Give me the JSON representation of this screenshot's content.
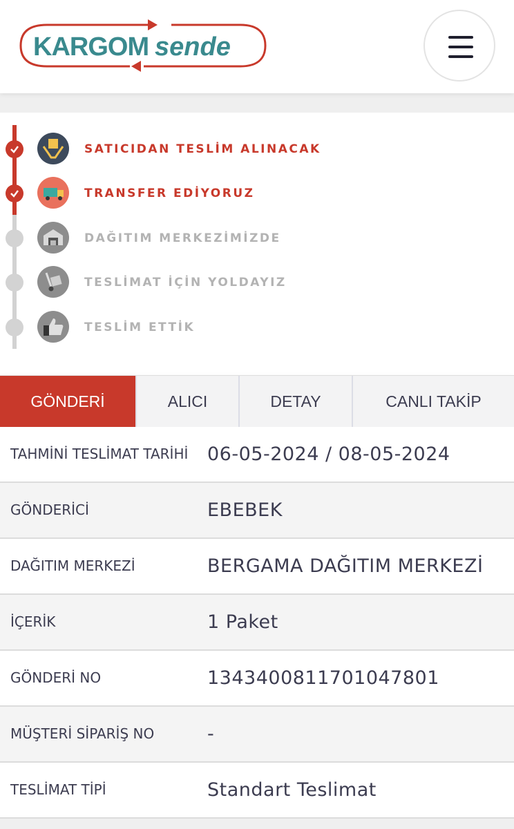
{
  "brand": {
    "part1": "KARGOM",
    "part2": "sende"
  },
  "colors": {
    "accent": "#c8392b",
    "brand_teal": "#3a8a8e",
    "text": "#3c3c50",
    "inactive": "#b3b3b3"
  },
  "steps": [
    {
      "label": "SATICIDAN TESLİM ALINACAK",
      "status": "done",
      "icon": "hands-box-icon"
    },
    {
      "label": "TRANSFER EDİYORUZ",
      "status": "done",
      "icon": "truck-icon"
    },
    {
      "label": "DAĞITIM MERKEZİMİZDE",
      "status": "pending",
      "icon": "warehouse-icon"
    },
    {
      "label": "TESLİMAT İÇİN YOLDAYIZ",
      "status": "pending",
      "icon": "hand-truck-icon"
    },
    {
      "label": "TESLİM ETTİK",
      "status": "pending",
      "icon": "thumbs-up-icon"
    }
  ],
  "tabs": [
    {
      "label": "GÖNDERİ",
      "active": true
    },
    {
      "label": "ALICI",
      "active": false
    },
    {
      "label": "DETAY",
      "active": false
    },
    {
      "label": "CANLI TAKİP",
      "active": false
    }
  ],
  "details": [
    {
      "key": "TAHMİNİ TESLİMAT TARİHİ",
      "value": "06-05-2024 / 08-05-2024"
    },
    {
      "key": "GÖNDERİCİ",
      "value": "EBEBEK"
    },
    {
      "key": "DAĞITIM MERKEZİ",
      "value": "BERGAMA DAĞITIM MERKEZİ"
    },
    {
      "key": "İÇERİK",
      "value": "1 Paket"
    },
    {
      "key": "GÖNDERİ NO",
      "value": "1343400811701047801"
    },
    {
      "key": "MÜŞTERİ SİPARİŞ NO",
      "value": "-"
    },
    {
      "key": "TESLİMAT TİPİ",
      "value": "Standart Teslimat"
    }
  ]
}
